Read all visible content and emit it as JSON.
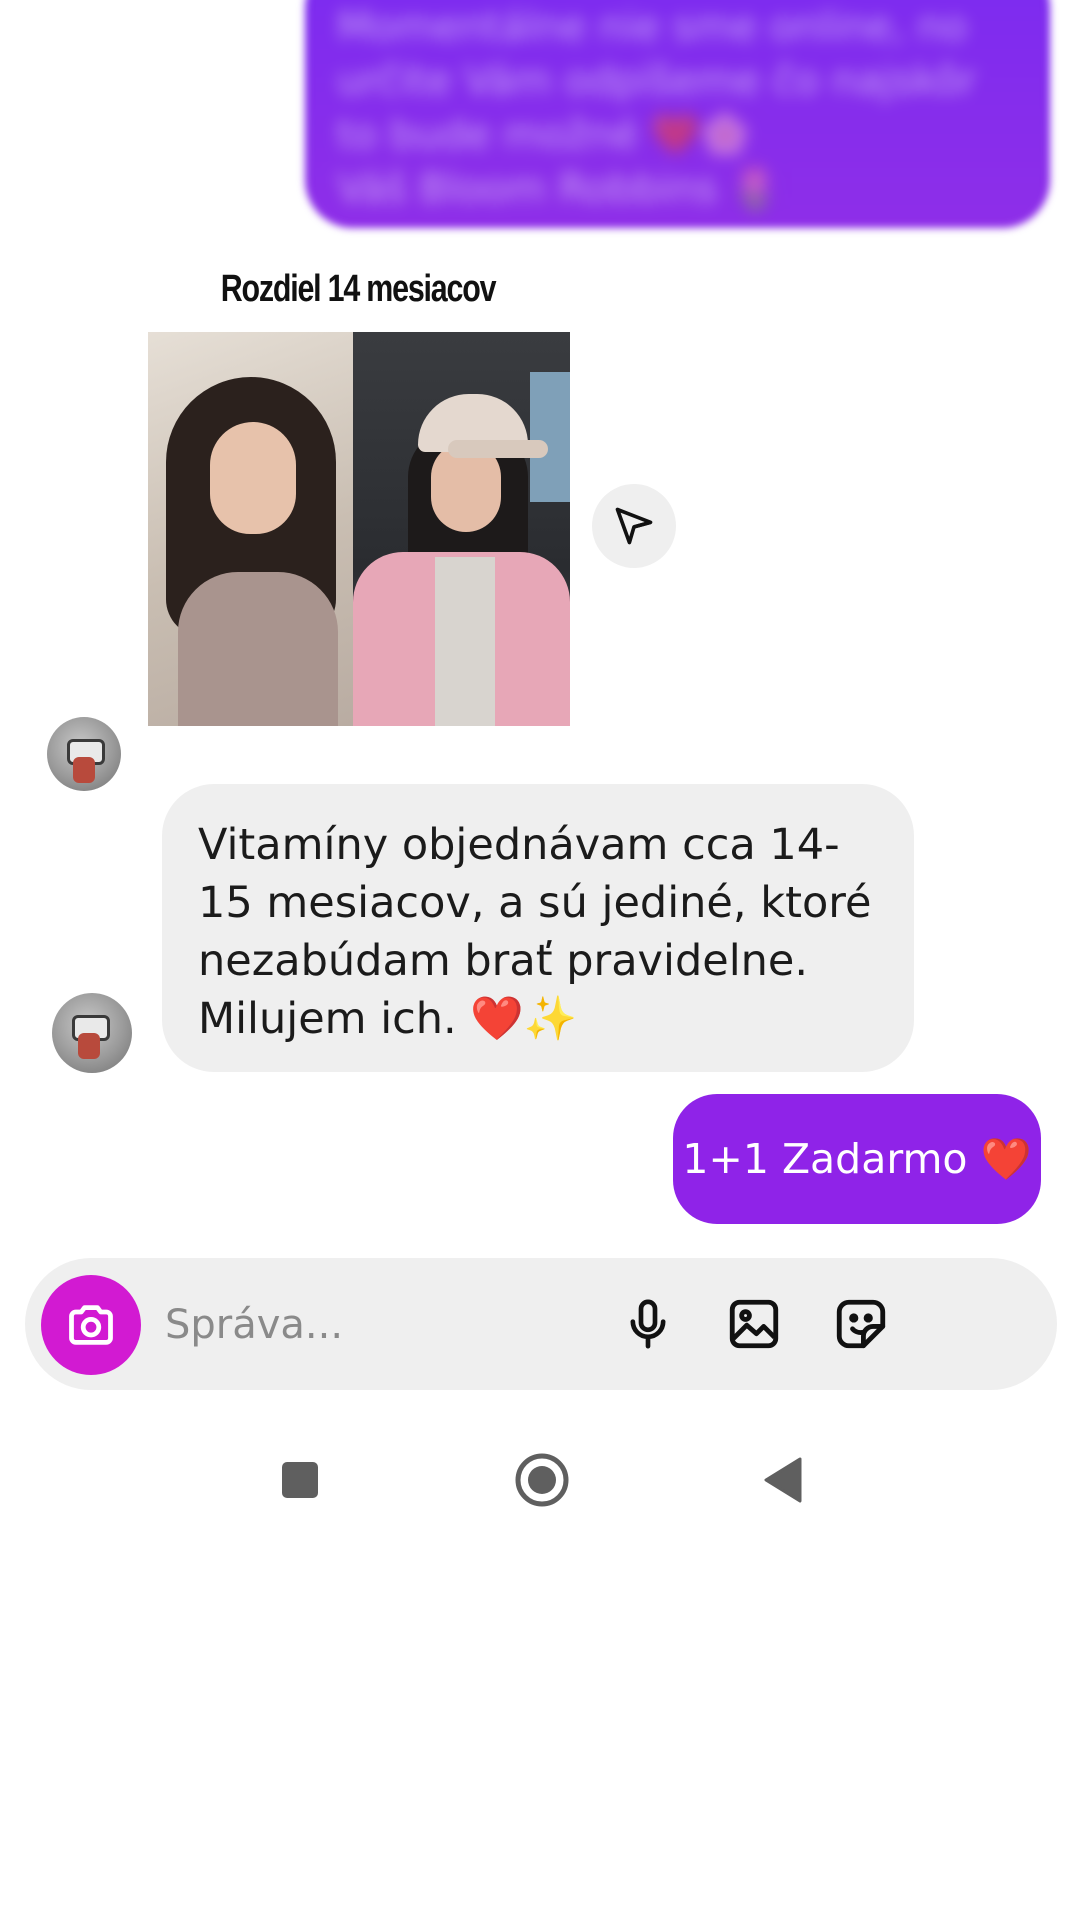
{
  "top_message": {
    "text": "Momentálne nie sme online, no určite Vám odpíšeme čo najskôr to bude možné ❤️🌸\nVáš Bloom Robbins 🌷"
  },
  "shared_post": {
    "title": "Rozdiel 14 mesiacov"
  },
  "incoming_message": {
    "text": "Vitamíny objednávam cca 14-15 mesiacov, a sú jediné, ktoré nezabúdam brať pravidelne. Milujem ich. ❤️✨"
  },
  "outgoing_message": {
    "text": "1+1 Zadarmo ❤️"
  },
  "composer": {
    "placeholder": "Správa..."
  },
  "icons": {
    "share": "send-icon",
    "camera": "camera-icon",
    "mic": "microphone-icon",
    "gallery": "image-icon",
    "sticker": "sticker-icon",
    "nav_recents": "square-icon",
    "nav_home": "circle-icon",
    "nav_back": "back-triangle-icon"
  },
  "colors": {
    "outgoing_bubble": "#8f23e8",
    "incoming_bubble": "#efefef",
    "camera_button": "#d21ad2"
  }
}
